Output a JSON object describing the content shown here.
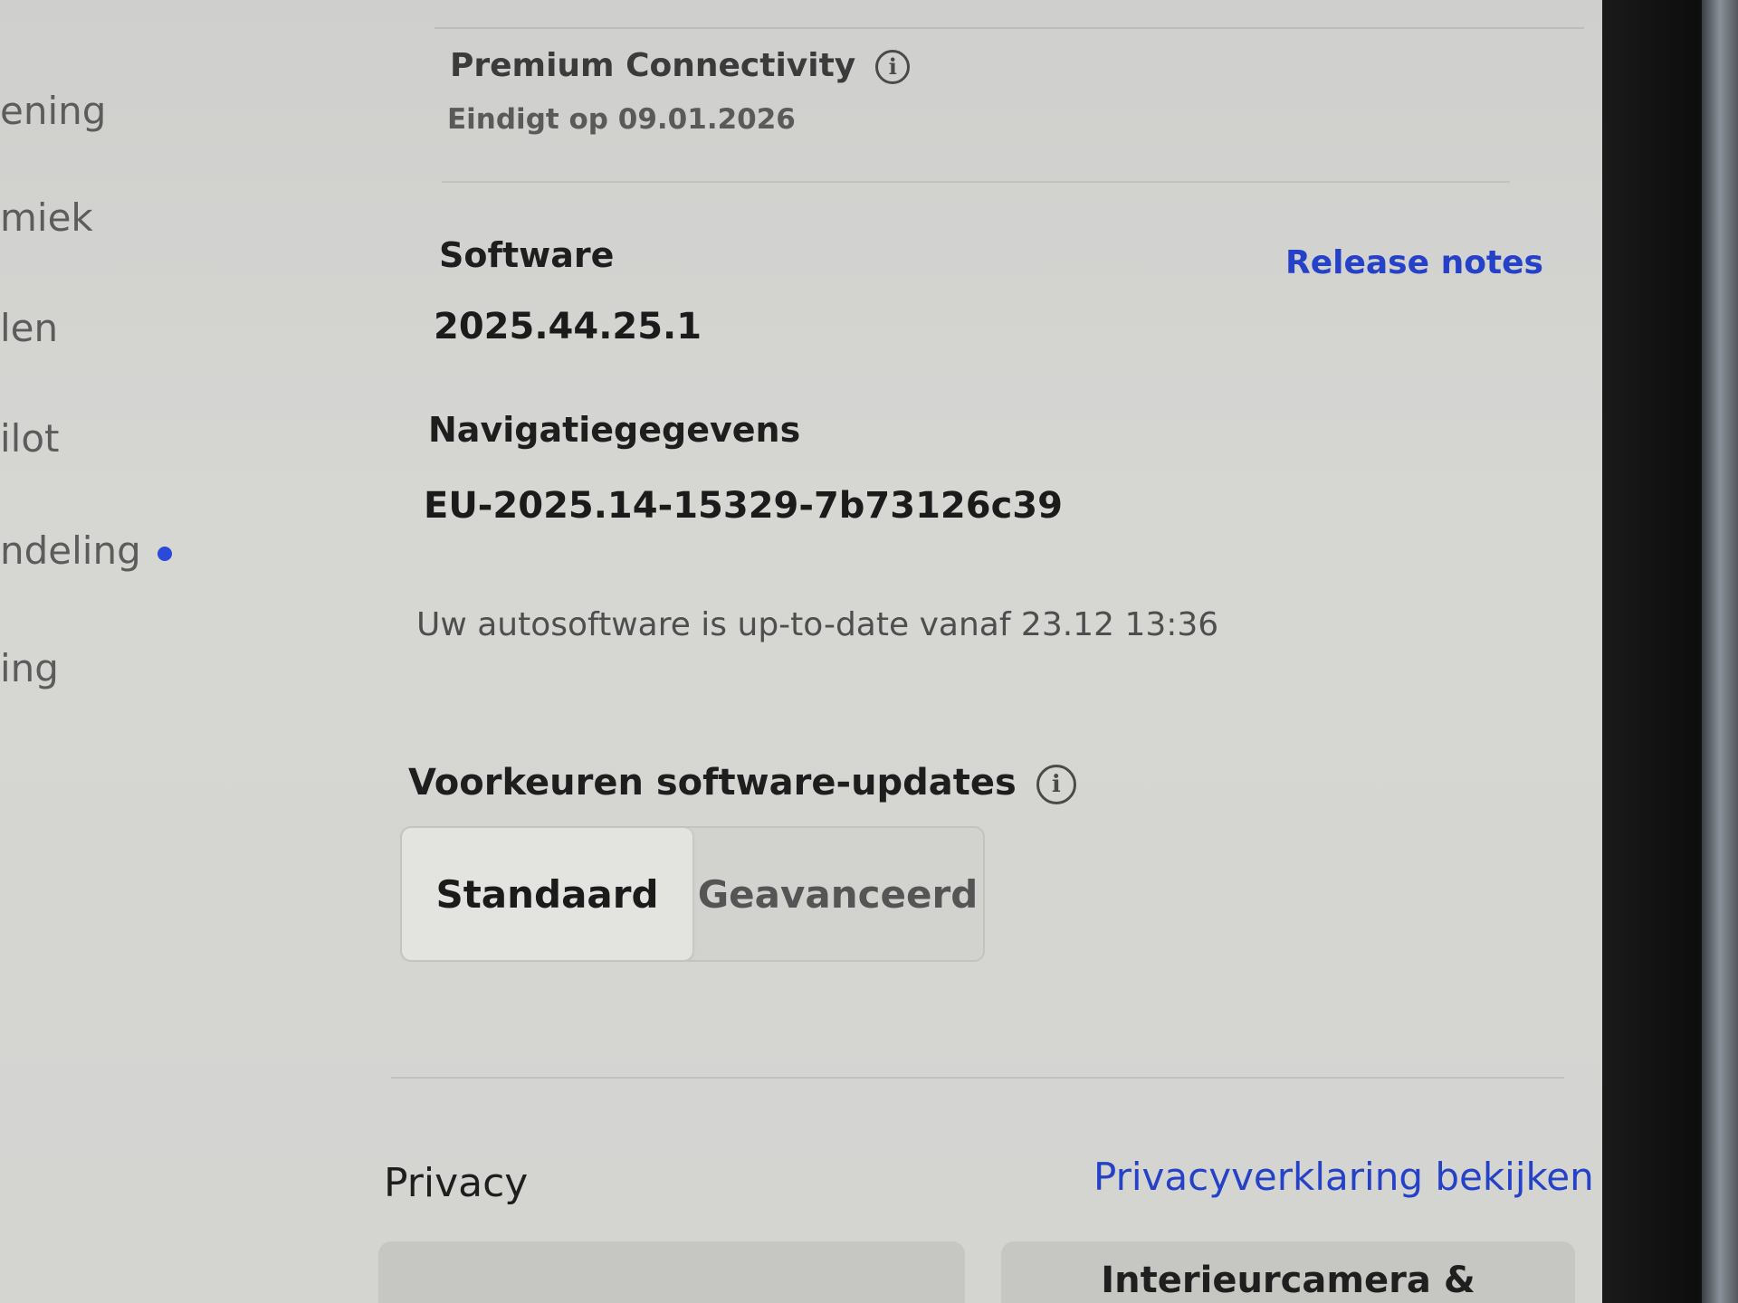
{
  "sidebar": {
    "items": [
      {
        "label": "ening"
      },
      {
        "label": "miek"
      },
      {
        "label": "len"
      },
      {
        "label": "ilot"
      },
      {
        "label": "ndeling"
      },
      {
        "label": "ing"
      }
    ]
  },
  "connectivity": {
    "title": "Premium Connectivity",
    "expires": "Eindigt op 09.01.2026"
  },
  "software": {
    "label": "Software",
    "version": "2025.44.25.1",
    "release_notes_link": "Release notes"
  },
  "navigation_data": {
    "label": "Navigatiegegevens",
    "value": "EU-2025.14-15329-7b73126c39"
  },
  "status": {
    "text": "Uw autosoftware is up-to-date vanaf 23.12 13:36"
  },
  "update_preferences": {
    "title": "Voorkeuren software-updates",
    "options": [
      "Standaard",
      "Geavanceerd"
    ],
    "selected": "Standaard"
  },
  "privacy": {
    "title": "Privacy",
    "statement_link": "Privacyverklaring bekijken",
    "cards": [
      "",
      "Interieurcamera &"
    ]
  },
  "colors": {
    "accent": "#2441c8",
    "indicator_dot": "#2a4bd7"
  },
  "icons": {
    "info": "info-icon"
  }
}
